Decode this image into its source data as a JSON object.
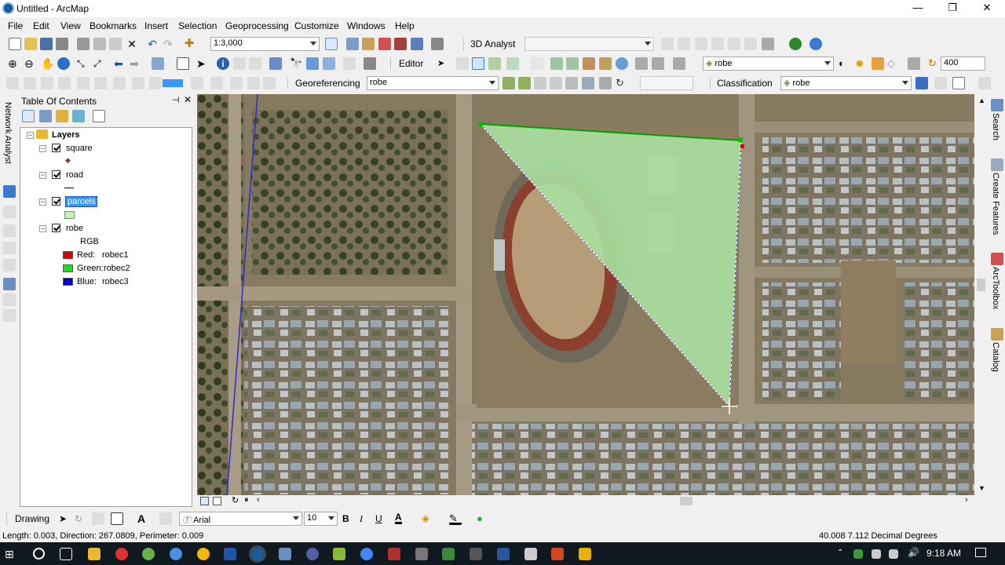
{
  "window": {
    "title": "Untitled - ArcMap",
    "controls": [
      "—",
      "❐",
      "✕"
    ]
  },
  "menu": [
    "File",
    "Edit",
    "View",
    "Bookmarks",
    "Insert",
    "Selection",
    "Geoprocessing",
    "Customize",
    "Windows",
    "Help"
  ],
  "toolbar1": {
    "scale": "1:3,000",
    "analyst_label": "3D Analyst",
    "analyst_layer": ""
  },
  "toolbar2": {
    "editor_label": "Editor",
    "layer_select": "robe",
    "zoom_value": "400"
  },
  "toolbar3": {
    "georef_label": "Georeferencing",
    "georef_layer": "robe",
    "classification_label": "Classification",
    "classification_layer": "robe"
  },
  "left_tab": "Network Analyst",
  "toc": {
    "title": "Table Of Contents",
    "root": "Layers",
    "layers": [
      {
        "name": "square"
      },
      {
        "name": "road"
      },
      {
        "name": "parcels"
      },
      {
        "name": "robe"
      }
    ],
    "rgb_label": "RGB",
    "bands": [
      {
        "label": "Red:",
        "value": "robec1",
        "color": "#e00000"
      },
      {
        "label": "Green:",
        "value": "robec2",
        "color": "#22dd22"
      },
      {
        "label": "Blue:",
        "value": "robec3",
        "color": "#0000dd"
      }
    ]
  },
  "right_tabs": [
    "Search",
    "Create Features",
    "ArcToolbox",
    "Catalog"
  ],
  "drawing": {
    "label": "Drawing",
    "font": "Arial",
    "size": "10",
    "bold": "B",
    "italic": "I",
    "underline": "U",
    "font_color_glyph": "A"
  },
  "status": {
    "left": "Length: 0.003, Direction: 267.0809, Perimeter: 0.009",
    "coords": "40.008  7.112 Decimal Degrees"
  },
  "taskbar": {
    "time": "9:18 AM"
  },
  "colors": {
    "parcel_fill": "#a8e0a0",
    "parcel_edge": "#00a000",
    "selected_highlight": "#3399ff"
  }
}
